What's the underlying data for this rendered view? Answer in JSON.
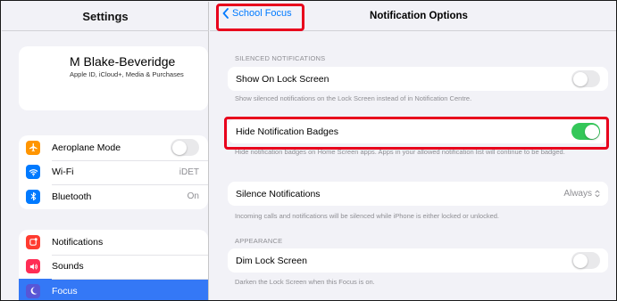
{
  "sidebar": {
    "title": "Settings",
    "profile": {
      "name": "M Blake-Beveridge",
      "subtitle": "Apple ID, iCloud+, Media & Purchases"
    },
    "group1": [
      {
        "label": "Aeroplane Mode",
        "icon": "airplane-icon",
        "icon_color": "#ff9500",
        "toggle": false
      },
      {
        "label": "Wi-Fi",
        "icon": "wifi-icon",
        "icon_color": "#007aff",
        "value": "iDET"
      },
      {
        "label": "Bluetooth",
        "icon": "bluetooth-icon",
        "icon_color": "#007aff",
        "value": "On"
      }
    ],
    "group2": [
      {
        "label": "Notifications",
        "icon": "notifications-icon",
        "icon_color": "#ff3b30"
      },
      {
        "label": "Sounds",
        "icon": "speaker-icon",
        "icon_color": "#ff2d55"
      },
      {
        "label": "Focus",
        "icon": "moon-icon",
        "icon_color": "#5856d6",
        "selected": true
      }
    ]
  },
  "main": {
    "back_label": "School Focus",
    "title": "Notification Options",
    "silenced_section": "SILENCED NOTIFICATIONS",
    "show_on_lock_screen": {
      "label": "Show On Lock Screen",
      "on": false
    },
    "show_on_lock_screen_note": "Show silenced notifications on the Lock Screen instead of in Notification Centre.",
    "hide_badges": {
      "label": "Hide Notification Badges",
      "on": true
    },
    "hide_badges_note": "Hide notification badges on Home Screen apps. Apps in your allowed notification list will continue to be badged.",
    "silence_notifications": {
      "label": "Silence Notifications",
      "value": "Always"
    },
    "silence_note": "Incoming calls and notifications will be silenced while iPhone is either locked or unlocked.",
    "appearance_section": "APPEARANCE",
    "dim_lock_screen": {
      "label": "Dim Lock Screen",
      "on": false
    },
    "dim_note": "Darken the Lock Screen when this Focus is on."
  },
  "colors": {
    "accent": "#007aff",
    "toggle_on": "#34c759",
    "highlight": "#e8001c",
    "selection": "#3478f6"
  }
}
